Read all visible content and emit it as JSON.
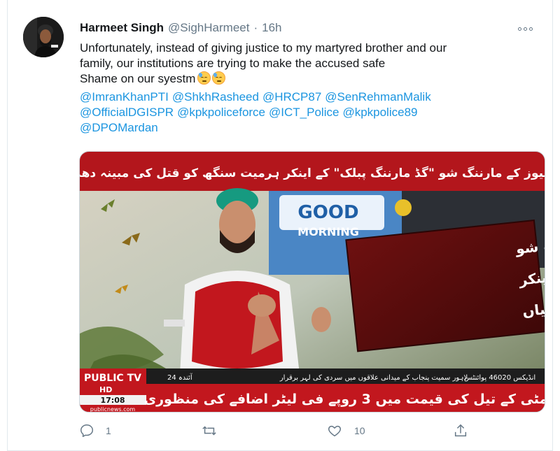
{
  "tweet": {
    "author_name": "Harmeet Singh",
    "handle": "@SighHarmeet",
    "separator": "·",
    "time": "16h",
    "text_lines": [
      "Unfortunately, instead of giving justice to my martyred brother and our",
      "family, our institutions are trying to make the accused safe",
      "Shame on our syestm"
    ],
    "mentions": [
      [
        "@ImranKhanPTI",
        "@ShkhRasheed",
        "@HRCP87",
        "@SenRehmanMalik"
      ],
      [
        "@OfficialDGISPR",
        "@kpkpoliceforce",
        "@ICT_Police",
        "@kpkpolice89"
      ],
      [
        "@DPOMardan"
      ]
    ],
    "emoji": [
      "downcast-face-with-sweat",
      "downcast-face-with-sweat"
    ]
  },
  "media": {
    "top_banner": "پبلک نیوز کے مارننگ شو \"گڈ مارننگ پبلک\" کے اینکر ہرمیت سنگھ کو قتل کی مبینہ دھمکیاں",
    "panel_line_1": "پبلک نیوز کے مارننگ شو",
    "panel_line_2": "\"گڈ مارننگ پبلک\" کے اینکر",
    "panel_line_3": "ہرمیت سنگھ کو قتل کی دھمکیاں",
    "set_text_1": "GOOD",
    "set_text_2": "MORNING",
    "channel_logo": "PUBLIC TV",
    "hd": "HD",
    "clock": "17:08",
    "website": "publicnews.com",
    "ticker_small": "لاہور سمیت پنجاب کے میدانی علاقوں میں سردی کی لہر برقرار",
    "ticker_right": "انڈیکس 46020 پوائنٹس",
    "ticker_left": "آئندہ 24",
    "ticker_main": "مٹی کے تیل کی قیمت میں 3 روپے فی لیٹر اضافے کی منظوری"
  },
  "actions": {
    "reply_count": "1",
    "retweet_count": "",
    "like_count": "10"
  },
  "colors": {
    "link": "#1b95e0",
    "muted": "#657786",
    "news_red": "#b3161c"
  }
}
